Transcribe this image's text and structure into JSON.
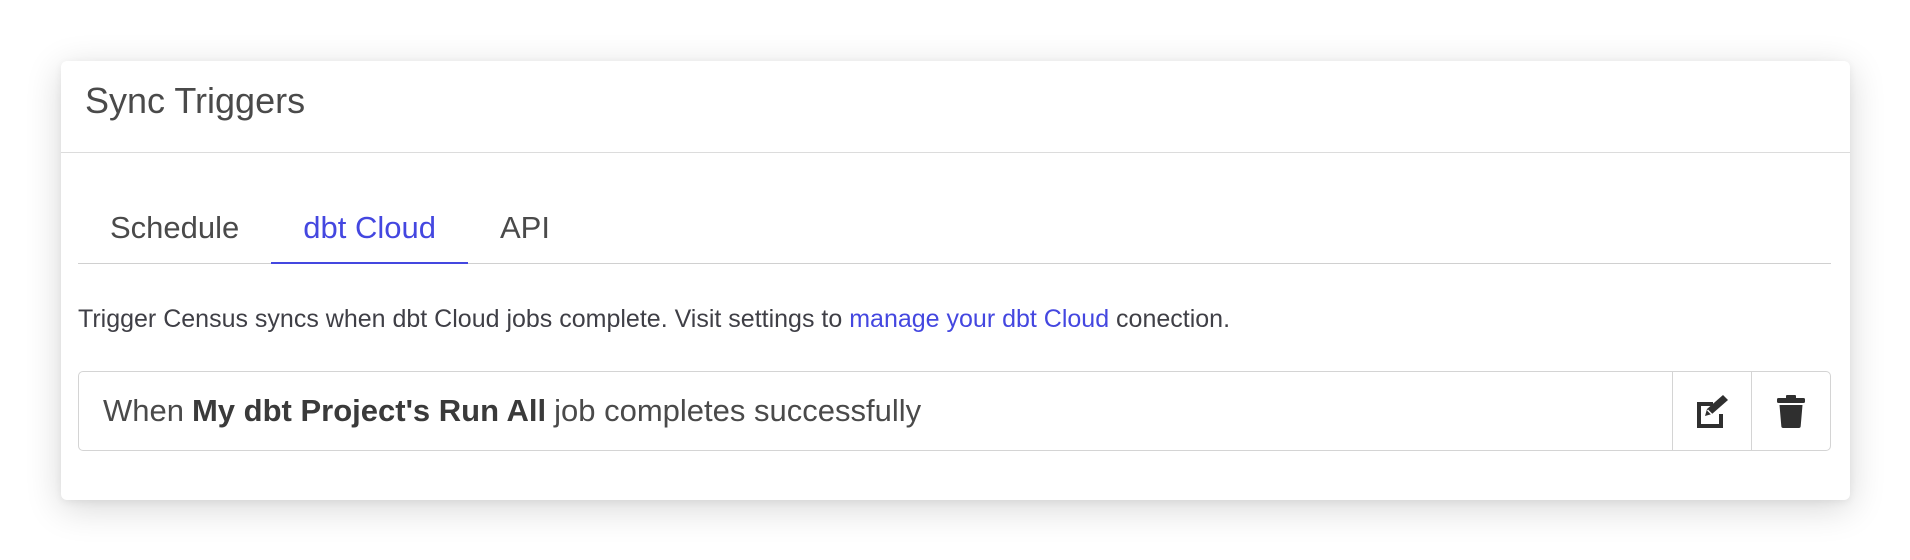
{
  "card": {
    "title": "Sync Triggers"
  },
  "tabs": [
    {
      "label": "Schedule",
      "active": false
    },
    {
      "label": "dbt Cloud",
      "active": true
    },
    {
      "label": "API",
      "active": false
    }
  ],
  "description": {
    "before": "Trigger Census syncs when dbt Cloud jobs complete. Visit settings to ",
    "link": "manage your dbt Cloud",
    "after": " conection."
  },
  "trigger": {
    "prefix": "When",
    "job_name": "My dbt Project's Run All",
    "suffix": "job completes successfully",
    "edit_icon": "edit-icon",
    "delete_icon": "trash-icon"
  },
  "colors": {
    "accent": "#4447e0",
    "text": "#4a4a4a",
    "border": "#d4d4d4"
  }
}
